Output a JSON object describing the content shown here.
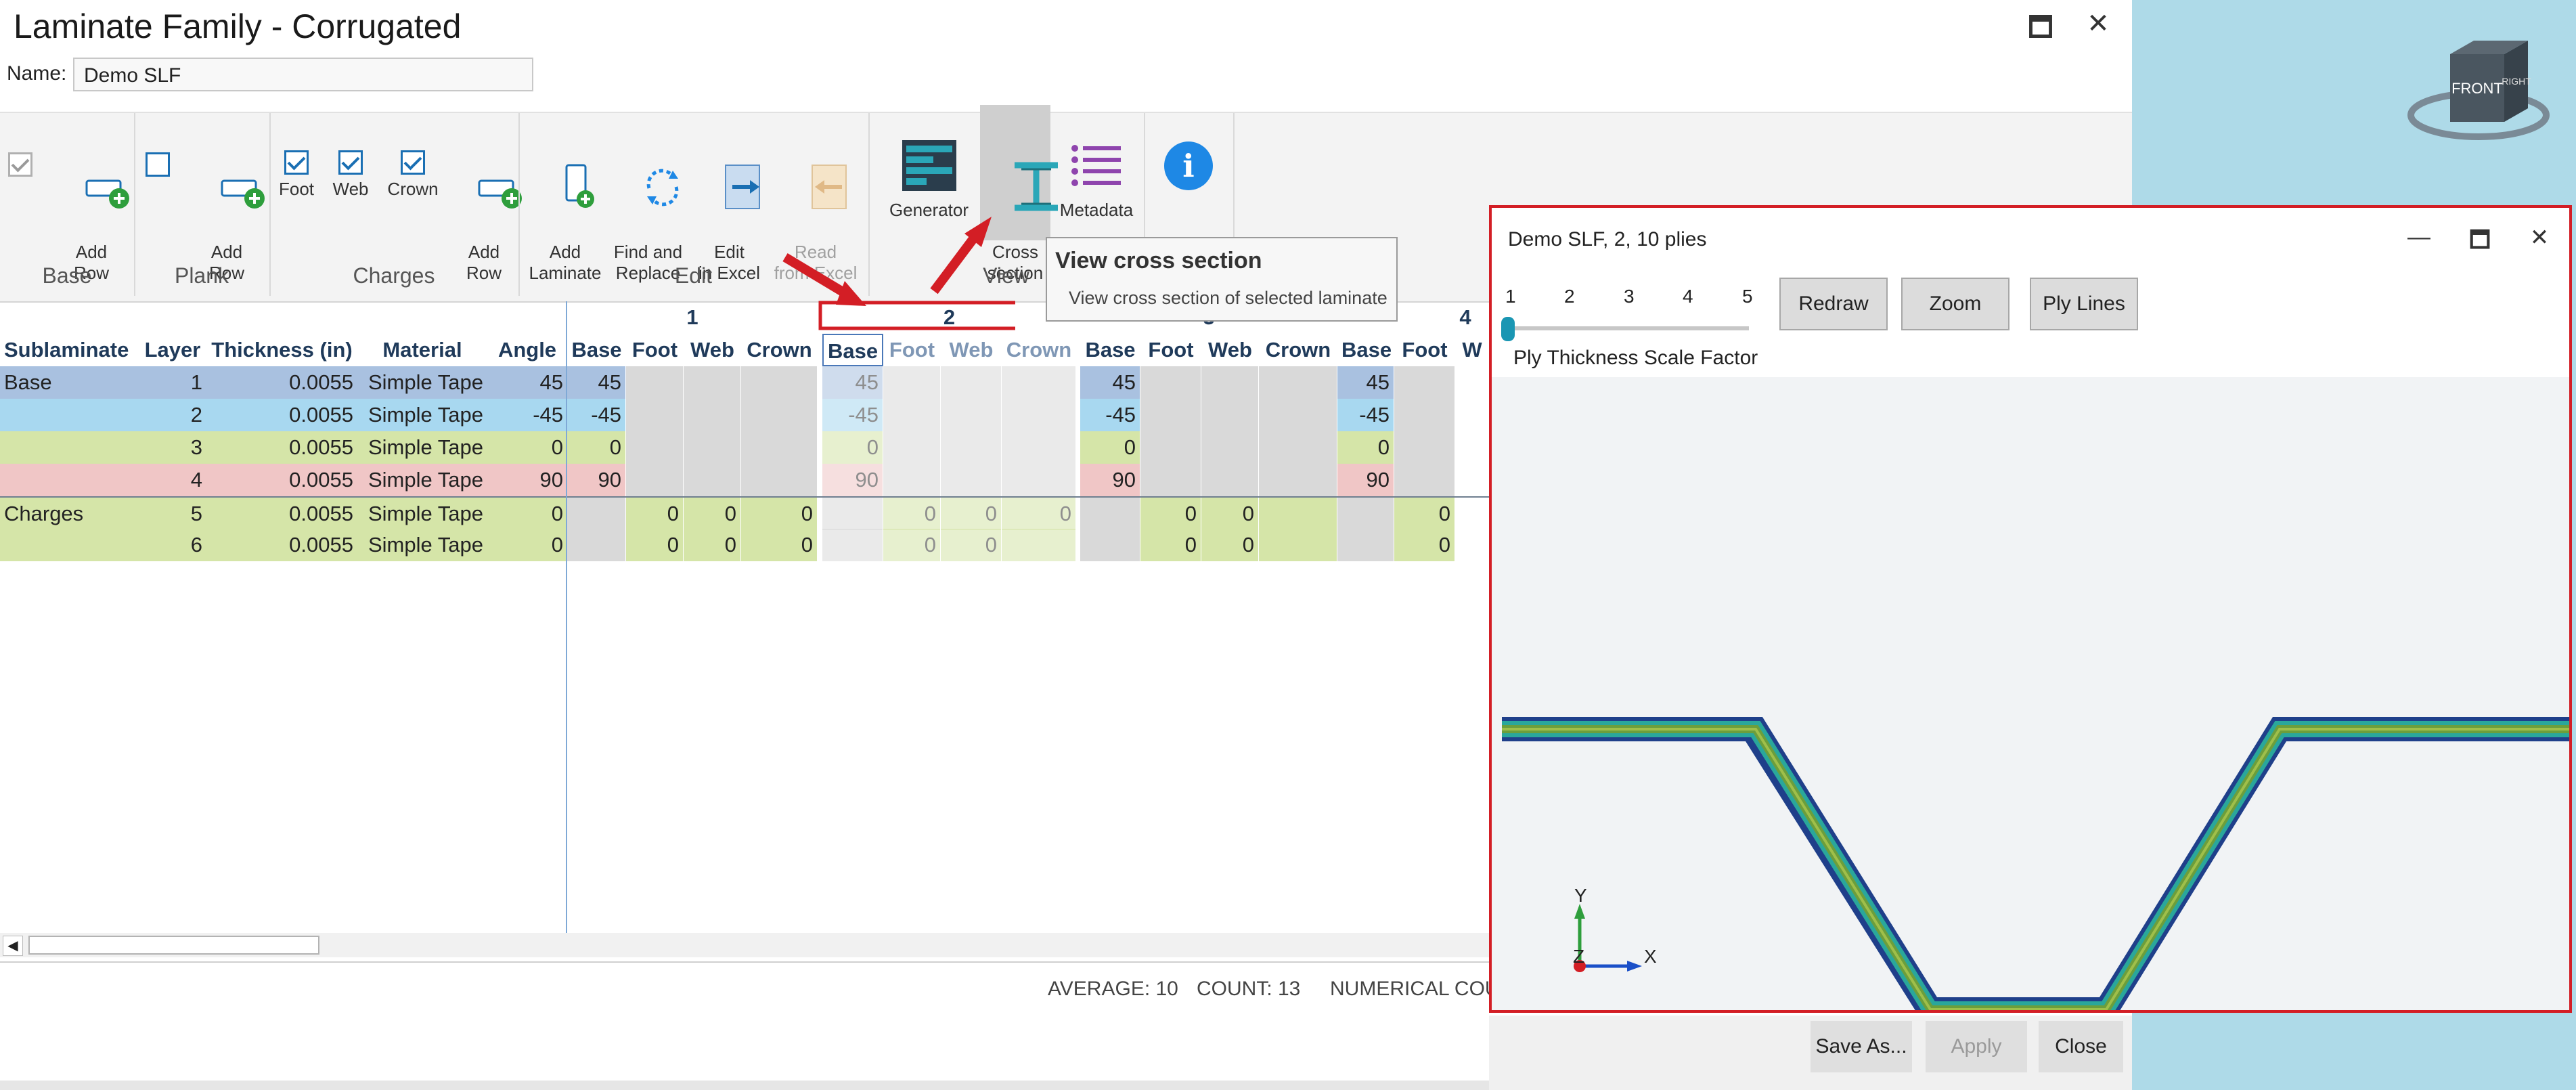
{
  "window": {
    "title": "Laminate Family - Corrugated",
    "name_label": "Name:",
    "name_value": "Demo SLF",
    "maximize_glyph": "🗖",
    "close_glyph": "✕"
  },
  "ribbon": {
    "groups": {
      "base": "Base",
      "plank": "Plank",
      "charges": "Charges",
      "edit": "Edit",
      "view": "View"
    },
    "base_add_row": "Add\nRow",
    "plank_add_row": "Add\nRow",
    "charges_foot": "Foot",
    "charges_web": "Web",
    "charges_crown": "Crown",
    "charges_add_row": "Add\nRow",
    "add_laminate": "Add\nLaminate",
    "find_replace": "Find and\nReplace",
    "edit_in_excel": "Edit\nin Excel",
    "read_from_excel": "Read\nfrom Excel",
    "generator": "Generator",
    "cross_section": "Cross\nsection",
    "metadata": "Metadata",
    "info": "i"
  },
  "tooltip": {
    "title": "View cross section",
    "body": "View cross section of selected laminate"
  },
  "grid": {
    "group_headers": [
      "1",
      "2",
      "3",
      "4"
    ],
    "columns": [
      "Sublaminate",
      "Layer",
      "Thickness (in)",
      "Material",
      "Angle",
      "Base",
      "Foot",
      "Web",
      "Crown",
      "Base",
      "Foot",
      "Web",
      "Crown",
      "Base",
      "Foot",
      "Web",
      "Crown",
      "Base",
      "Foot",
      "W"
    ],
    "rows": [
      {
        "sub": "Base",
        "layer": "1",
        "thk": "0.0055",
        "mat": "Simple Tape",
        "angle": "45",
        "g1": [
          "45",
          "",
          "",
          ""
        ],
        "g2": [
          "45",
          "",
          "",
          ""
        ],
        "g3": [
          "45",
          "",
          "",
          ""
        ],
        "g4": [
          "45",
          ""
        ]
      },
      {
        "sub": "",
        "layer": "2",
        "thk": "0.0055",
        "mat": "Simple Tape",
        "angle": "-45",
        "g1": [
          "-45",
          "",
          "",
          ""
        ],
        "g2": [
          "-45",
          "",
          "",
          ""
        ],
        "g3": [
          "-45",
          "",
          "",
          ""
        ],
        "g4": [
          "-45",
          ""
        ]
      },
      {
        "sub": "",
        "layer": "3",
        "thk": "0.0055",
        "mat": "Simple Tape",
        "angle": "0",
        "g1": [
          "0",
          "",
          "",
          ""
        ],
        "g2": [
          "0",
          "",
          "",
          ""
        ],
        "g3": [
          "0",
          "",
          "",
          ""
        ],
        "g4": [
          "0",
          ""
        ]
      },
      {
        "sub": "",
        "layer": "4",
        "thk": "0.0055",
        "mat": "Simple Tape",
        "angle": "90",
        "g1": [
          "90",
          "",
          "",
          ""
        ],
        "g2": [
          "90",
          "",
          "",
          ""
        ],
        "g3": [
          "90",
          "",
          "",
          ""
        ],
        "g4": [
          "90",
          ""
        ]
      },
      {
        "sub": "Charges",
        "layer": "5",
        "thk": "0.0055",
        "mat": "Simple Tape",
        "angle": "0",
        "g1": [
          "",
          "0",
          "0",
          "0"
        ],
        "g2": [
          "",
          "0",
          "0",
          "0"
        ],
        "g3": [
          "",
          "0",
          "0",
          ""
        ],
        "g4": [
          "",
          "0"
        ]
      },
      {
        "sub": "",
        "layer": "6",
        "thk": "0.0055",
        "mat": "Simple Tape",
        "angle": "0",
        "g1": [
          "",
          "0",
          "0",
          "0"
        ],
        "g2": [
          "",
          "0",
          "0",
          ""
        ],
        "g3": [
          "",
          "0",
          "0",
          ""
        ],
        "g4": [
          "",
          "0"
        ]
      }
    ],
    "row_colors": [
      "#a9c1e0",
      "#a8d8f0",
      "#d5e5a8",
      "#f0c6c6",
      "#d5e5a8",
      "#d5e5a8"
    ]
  },
  "status": {
    "average": "AVERAGE: 10",
    "count": "COUNT: 13",
    "numerical": "NUMERICAL COU"
  },
  "cross_window": {
    "title": "Demo SLF, 2, 10 plies",
    "scale_ticks": [
      "1",
      "2",
      "3",
      "4",
      "5"
    ],
    "scale_label": "Ply Thickness Scale Factor",
    "redraw": "Redraw",
    "zoom": "Zoom",
    "ply_lines": "Ply Lines",
    "axis_y": "Y",
    "axis_x": "X",
    "axis_z": "Z",
    "minimize_glyph": "—",
    "maximize_glyph": "🗖",
    "close_glyph": "✕"
  },
  "view_cube": {
    "front": "FRONT",
    "right": "RIGHT"
  },
  "dialog_buttons": {
    "save_as": "Save As...",
    "apply": "Apply",
    "close": "Close"
  }
}
